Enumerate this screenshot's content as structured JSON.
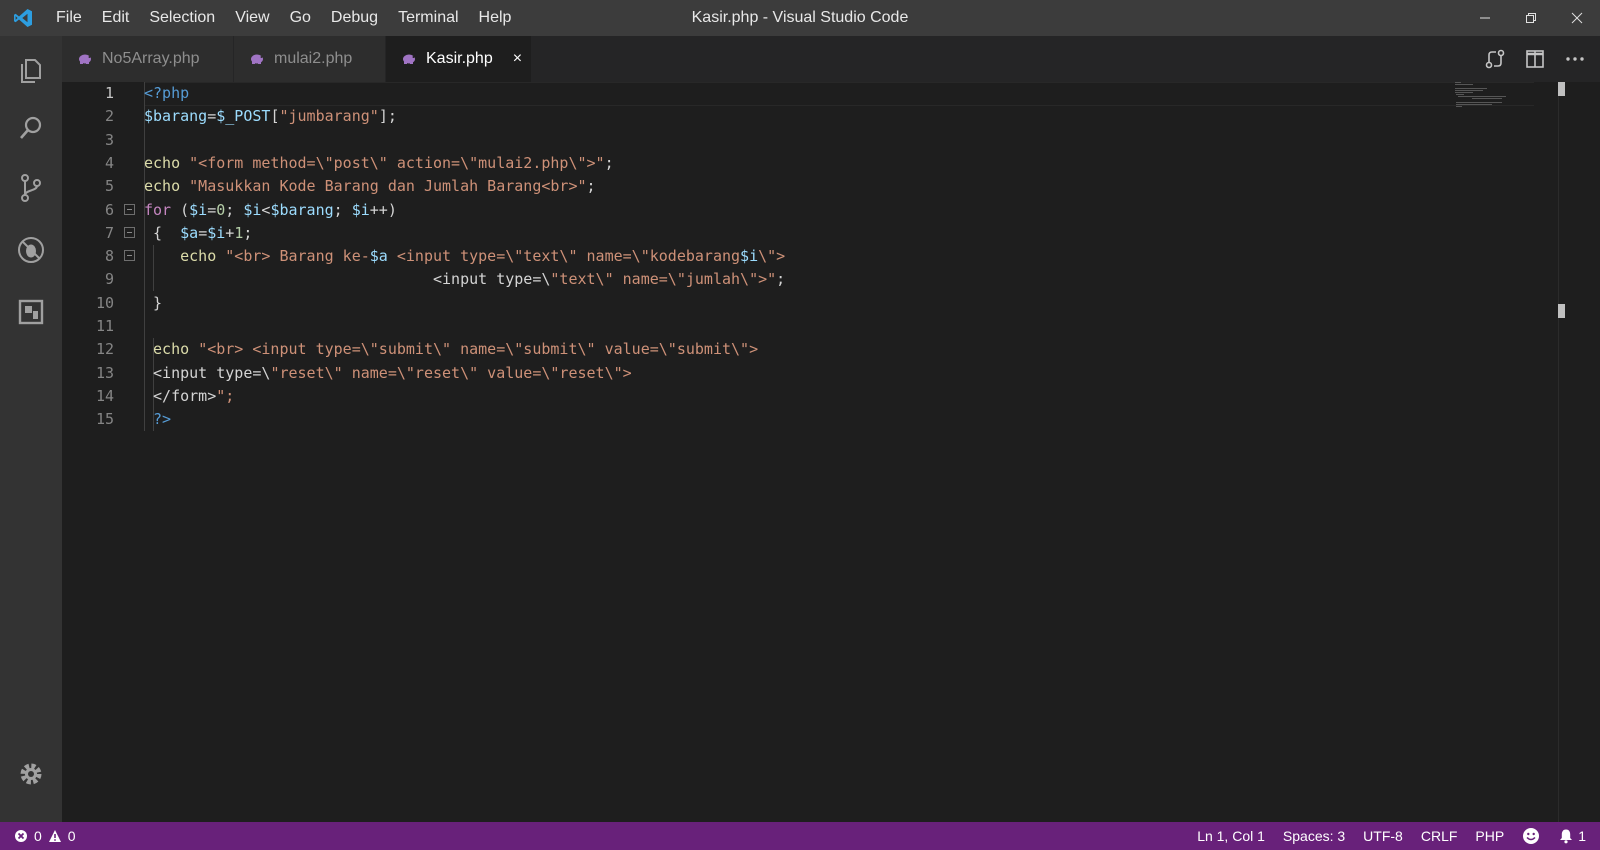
{
  "window": {
    "title": "Kasir.php - Visual Studio Code",
    "menu": [
      "File",
      "Edit",
      "Selection",
      "View",
      "Go",
      "Debug",
      "Terminal",
      "Help"
    ]
  },
  "tabs": [
    {
      "label": "No5Array.php",
      "active": false
    },
    {
      "label": "mulai2.php",
      "active": false
    },
    {
      "label": "Kasir.php",
      "active": true
    }
  ],
  "tab_close_glyph": "×",
  "editor": {
    "current_line": 1,
    "line_numbers": [
      "1",
      "2",
      "3",
      "4",
      "5",
      "6",
      "7",
      "8",
      "9",
      "10",
      "11",
      "12",
      "13",
      "14",
      "15"
    ],
    "lines": [
      "<?php",
      "$barang=$_POST[\"jumbarang\"];",
      "",
      "echo \"<form method=\\\"post\\\" action=\\\"mulai2.php\\\">\";",
      "echo \"Masukkan Kode Barang dan Jumlah Barang<br>\";",
      "for ($i=0; $i<$barang; $i++)",
      " {  $a=$i+1;",
      "    echo \"<br> Barang ke-$a <input type=\\\"text\\\" name=\\\"kodebarang$i\\\">",
      "                                <input type=\\\"text\\\" name=\\\"jumlah\\\">\";",
      " }",
      "",
      " echo \"<br> <input type=\\\"submit\\\" name=\\\"submit\\\" value=\\\"submit\\\">",
      " <input type=\\\"reset\\\" name=\\\"reset\\\" value=\\\"reset\\\">",
      " </form>\";",
      " ?>"
    ]
  },
  "statusbar": {
    "errors": "0",
    "warnings": "0",
    "position": "Ln 1, Col 1",
    "spaces": "Spaces: 3",
    "encoding": "UTF-8",
    "eol": "CRLF",
    "language": "PHP",
    "notifications": "1"
  },
  "colors": {
    "statusbar": "#68217a",
    "titlebar": "#3c3c3c",
    "activitybar": "#333333",
    "editor": "#1e1e1e",
    "php_icon": "#a074c4"
  },
  "icons": {
    "app": "vscode-logo-icon",
    "activity": [
      "explorer-icon",
      "search-icon",
      "source-control-icon",
      "debug-icon",
      "extensions-icon",
      "gear-icon"
    ],
    "editor_actions": [
      "compare-changes-icon",
      "split-editor-icon",
      "more-actions-icon"
    ]
  }
}
